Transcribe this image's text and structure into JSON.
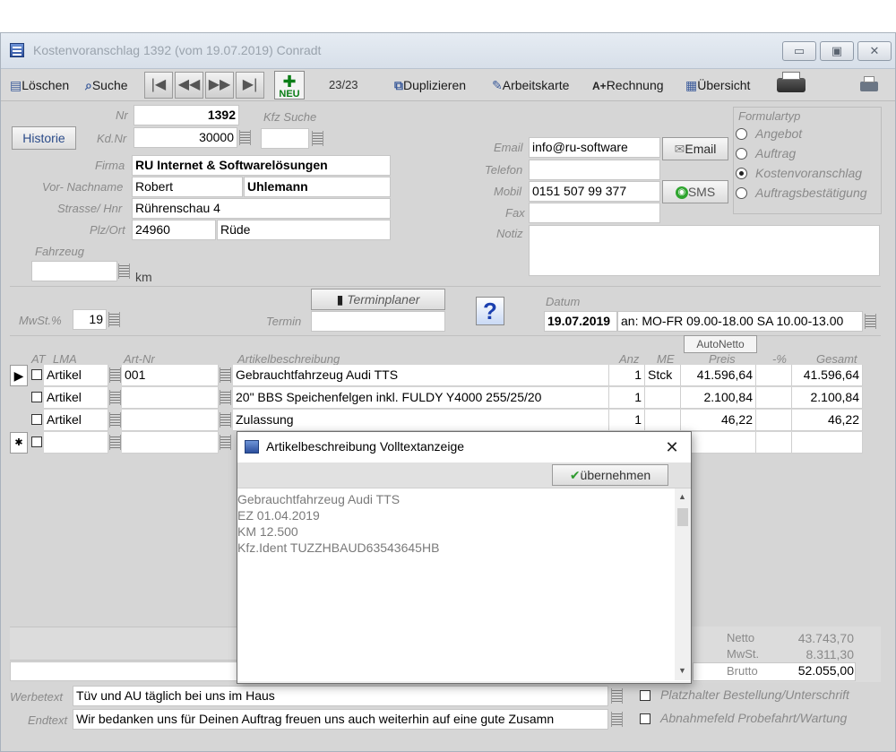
{
  "window": {
    "title": "Kostenvoranschlag  1392 (vom 19.07.2019)  Conradt",
    "min": "▭",
    "max": "▣",
    "close": "✕"
  },
  "toolbar": {
    "delete": "Löschen",
    "search": "Suche",
    "new": "NEU",
    "record": "23/23",
    "duplicate": "Duplizieren",
    "worksheet": "Arbeitskarte",
    "invoice": "Rechnung",
    "overview": "Übersicht",
    "invoice_icon": "A+"
  },
  "customer": {
    "nr_label": "Nr",
    "nr": "1392",
    "kfz_search_label": "Kfz Suche",
    "kfz_search": "",
    "kdnr_label": "Kd.Nr",
    "kdnr": "30000",
    "history_button": "Historie",
    "company_label": "Firma",
    "company": "RU Internet & Softwarelösungen",
    "name_label": "Vor- Nachname",
    "firstname": "Robert",
    "lastname": "Uhlemann",
    "street_label": "Strasse/ Hnr",
    "street": "Rührenschau 4",
    "city_label": "Plz/Ort",
    "zip": "24960",
    "city": "Rüde",
    "vehicle_label": "Fahrzeug",
    "vehicle": "",
    "km_unit": "km",
    "email_label": "Email",
    "email": "info@ru-software",
    "email_button": "Email",
    "phone_label": "Telefon",
    "phone": "",
    "mobile_label": "Mobil",
    "mobile": "0151 507 99 377",
    "sms_button": "SMS",
    "fax_label": "Fax",
    "fax": "",
    "note_label": "Notiz",
    "note": ""
  },
  "formtype": {
    "title": "Formulartyp",
    "options": [
      {
        "label": "Angebot",
        "selected": false
      },
      {
        "label": "Auftrag",
        "selected": false
      },
      {
        "label": "Kostenvoranschlag",
        "selected": true
      },
      {
        "label": "Auftragsbestätigung",
        "selected": false
      }
    ]
  },
  "terms": {
    "mwst_label": "MwSt.%",
    "mwst": "19",
    "termin_label": "Termin",
    "termin": "",
    "planner_button": "Terminplaner",
    "help_icon": "?",
    "date_label": "Datum",
    "date": "19.07.2019",
    "hours": "an: MO-FR 09.00-18.00 SA 10.00-13.00",
    "autonetto": "AutoNetto"
  },
  "grid": {
    "headers": {
      "at": "AT",
      "lma": "LMA",
      "artnr": "Art-Nr",
      "desc": "Artikelbeschreibung",
      "qty": "Anz",
      "unit": "ME",
      "price": "Preis",
      "disc": "-%",
      "total": "Gesamt"
    },
    "rows": [
      {
        "lma": "Artikel",
        "artnr": "001",
        "desc": "Gebrauchtfahrzeug Audi TTS",
        "qty": "1",
        "unit": "Stck",
        "price": "41.596,64",
        "total": "41.596,64",
        "marker": "▶"
      },
      {
        "lma": "Artikel",
        "artnr": "",
        "desc": "20\" BBS Speichenfelgen inkl. FULDY Y4000 255/25/20",
        "qty": "1",
        "unit": "",
        "price": "2.100,84",
        "total": "2.100,84",
        "marker": ""
      },
      {
        "lma": "Artikel",
        "artnr": "",
        "desc": "Zulassung",
        "qty": "1",
        "unit": "",
        "price": "46,22",
        "total": "46,22",
        "marker": ""
      },
      {
        "lma": "",
        "artnr": "",
        "desc": "",
        "qty": "",
        "unit": "",
        "price": "",
        "total": "",
        "marker": "✱"
      }
    ]
  },
  "totals": {
    "netto_label": "Netto",
    "netto": "43.743,70",
    "mwst_label": "MwSt.",
    "mwst": "8.311,30",
    "brutto_label": "Brutto",
    "brutto": "52.055,00"
  },
  "footer": {
    "werbetext_label": "Werbetext",
    "werbetext": "Tüv und AU täglich bei uns im Haus",
    "endtext_label": "Endtext",
    "endtext": "Wir bedanken uns für Deinen Auftrag freuen uns auch weiterhin auf eine gute Zusamn",
    "check1": "Platzhalter Bestellung/Unterschrift",
    "check2": "Abnahmefeld Probefahrt/Wartung"
  },
  "dialog": {
    "title": "Artikelbeschreibung Volltextanzeige",
    "close": "✕",
    "apply_button": "übernehmen",
    "lines": [
      "Gebrauchtfahrzeug Audi TTS",
      "EZ 01.04.2019",
      "KM 12.500",
      "Kfz.Ident TUZZHBAUD63543645HB"
    ]
  }
}
